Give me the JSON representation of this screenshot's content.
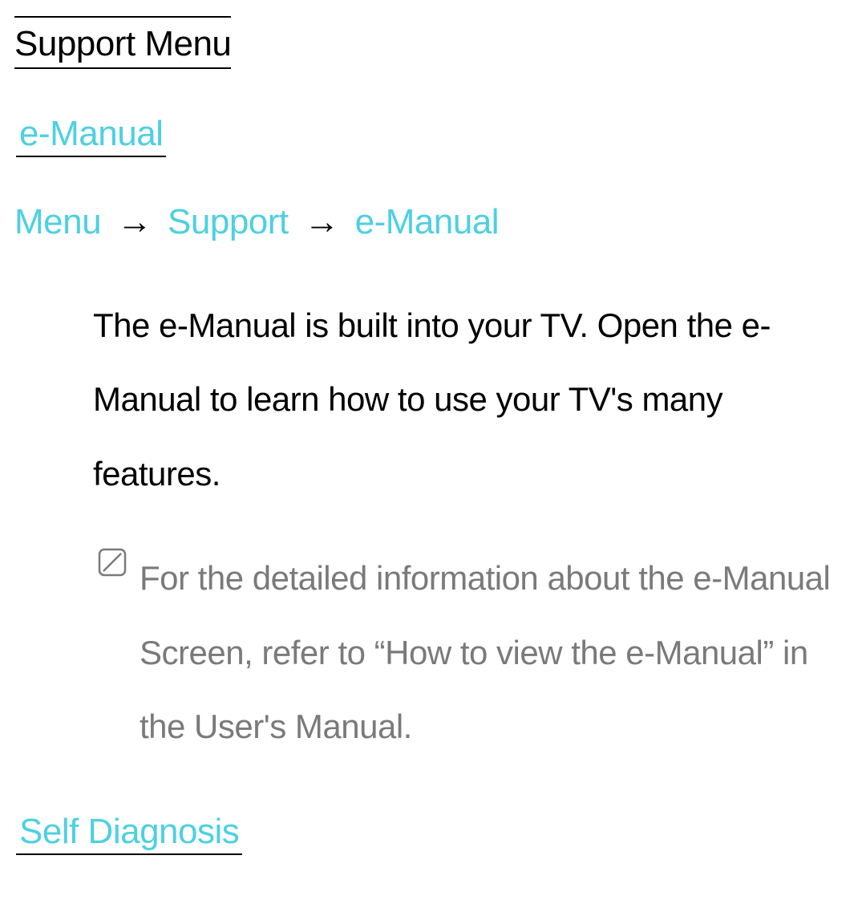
{
  "page_title": "Support Menu",
  "sections": {
    "emanual": {
      "heading": "e-Manual",
      "breadcrumb": {
        "items": [
          "Menu",
          "Support",
          "e-Manual"
        ],
        "separator": "→"
      },
      "body": "The e-Manual is built into your TV. Open the e-Manual to learn how to use your TV's many features.",
      "note": "For the detailed information about the e-Manual Screen, refer to “How to view the e-Manual” in the User's Manual."
    },
    "self_diagnosis": {
      "heading": "Self Diagnosis"
    }
  },
  "colors": {
    "accent": "#4dd0e1",
    "body": "#000000",
    "note": "#7a7a7a"
  }
}
